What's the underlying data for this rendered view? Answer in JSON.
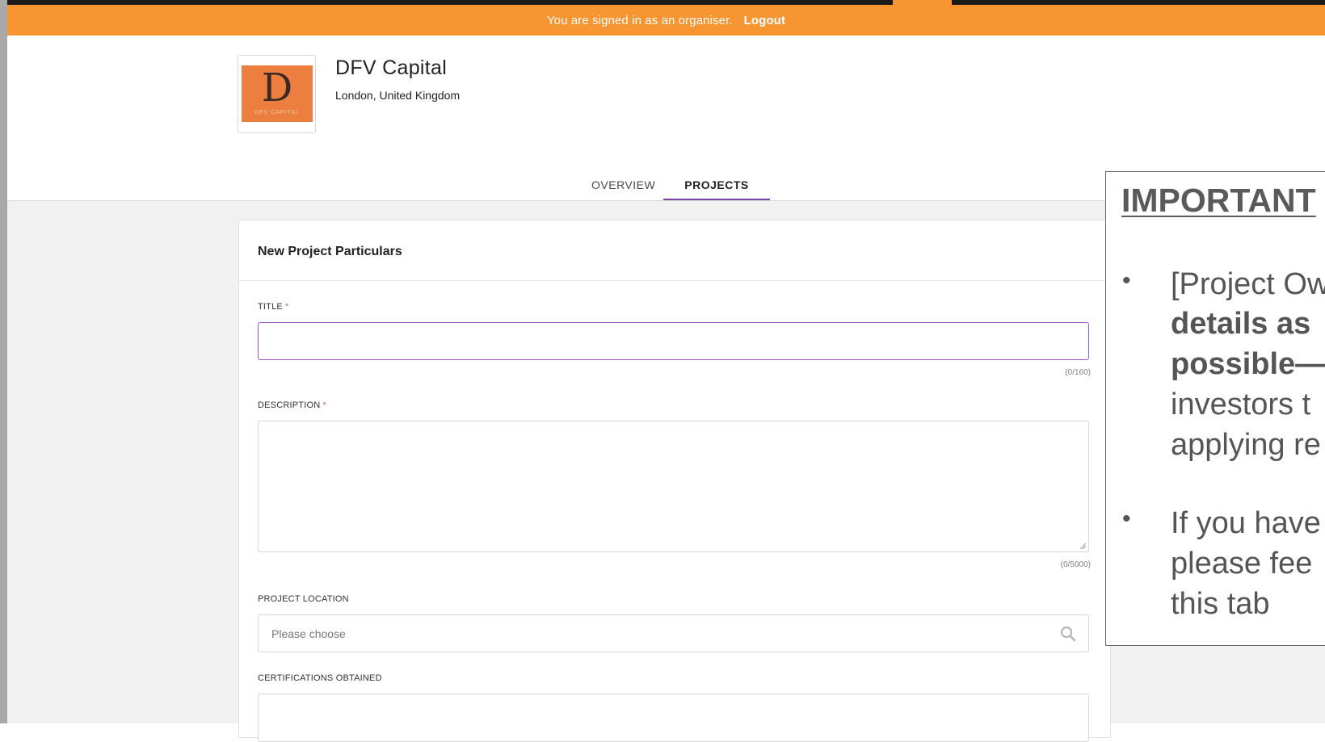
{
  "topbar": {
    "message": "You are signed in as an organiser.",
    "logout_label": "Logout"
  },
  "organisation": {
    "name": "DFV Capital",
    "location": "London, United Kingdom",
    "logo_letter": "D",
    "logo_caption": "DFV CAPITAL"
  },
  "tabs": [
    {
      "label": "OVERVIEW",
      "active": false
    },
    {
      "label": "PROJECTS",
      "active": true
    }
  ],
  "form": {
    "heading": "New Project Particulars",
    "fields": {
      "title": {
        "label": "TITLE",
        "required_mark": "*",
        "value": "",
        "counter": "(0/160)"
      },
      "description": {
        "label": "DESCRIPTION",
        "required_mark": "*",
        "value": "",
        "counter": "(0/5000)"
      },
      "location": {
        "label": "PROJECT LOCATION",
        "placeholder": "Please choose"
      },
      "certifications": {
        "label": "CERTIFICATIONS OBTAINED",
        "value": ""
      }
    }
  },
  "callout": {
    "title": "IMPORTANT",
    "bullet_1_lines": [
      "[Project Ow",
      "details as",
      "possible—",
      "investors t",
      "applying re"
    ],
    "bullet_2_lines": [
      "If you have",
      "please fee",
      "this tab"
    ]
  },
  "colors": {
    "accent_orange": "#f79532",
    "accent_purple": "#7a44a8",
    "required_red": "#e05b5b"
  }
}
